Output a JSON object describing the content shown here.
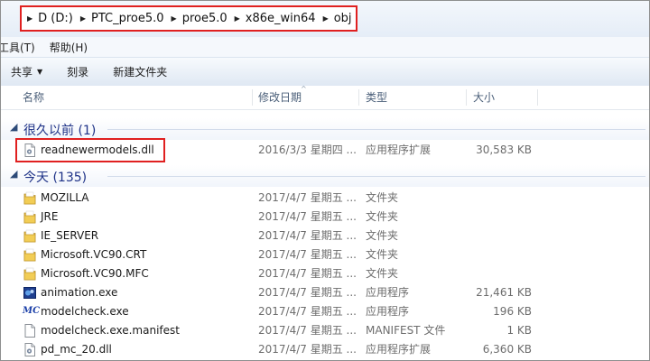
{
  "address": {
    "crumbs": [
      "D (D:)",
      "PTC_proe5.0",
      "proe5.0",
      "x86e_win64",
      "obj"
    ]
  },
  "menu": {
    "items": [
      "工具(T)",
      "帮助(H)"
    ]
  },
  "toolbar": {
    "share_label": "共享",
    "burn_label": "刻录",
    "new_folder_label": "新建文件夹"
  },
  "columns": {
    "name": "名称",
    "date": "修改日期",
    "type": "类型",
    "size": "大小"
  },
  "groups": [
    {
      "title": "很久以前 (1)",
      "files": [
        {
          "name": "readnewermodels.dll",
          "date": "2016/3/3 星期四 ...",
          "type": "应用程序扩展",
          "size": "30,583 KB",
          "icon": "dll-file-icon"
        }
      ]
    },
    {
      "title": "今天 (135)",
      "files": [
        {
          "name": "MOZILLA",
          "date": "2017/4/7 星期五 ...",
          "type": "文件夹",
          "size": "",
          "icon": "folder-icon"
        },
        {
          "name": "JRE",
          "date": "2017/4/7 星期五 ...",
          "type": "文件夹",
          "size": "",
          "icon": "folder-icon"
        },
        {
          "name": "IE_SERVER",
          "date": "2017/4/7 星期五 ...",
          "type": "文件夹",
          "size": "",
          "icon": "folder-icon"
        },
        {
          "name": "Microsoft.VC90.CRT",
          "date": "2017/4/7 星期五 ...",
          "type": "文件夹",
          "size": "",
          "icon": "folder-icon"
        },
        {
          "name": "Microsoft.VC90.MFC",
          "date": "2017/4/7 星期五 ...",
          "type": "文件夹",
          "size": "",
          "icon": "folder-icon"
        },
        {
          "name": "animation.exe",
          "date": "2017/4/7 星期五 ...",
          "type": "应用程序",
          "size": "21,461 KB",
          "icon": "animation-exe-icon"
        },
        {
          "name": "modelcheck.exe",
          "date": "2017/4/7 星期五 ...",
          "type": "应用程序",
          "size": "196 KB",
          "icon": "mc-exe-icon",
          "icon_text": "MC"
        },
        {
          "name": "modelcheck.exe.manifest",
          "date": "2017/4/7 星期五 ...",
          "type": "MANIFEST 文件",
          "size": "1 KB",
          "icon": "blank-file-icon"
        },
        {
          "name": "pd_mc_20.dll",
          "date": "2017/4/7 星期五 ...",
          "type": "应用程序扩展",
          "size": "6,360 KB",
          "icon": "dll-file-icon"
        }
      ]
    }
  ],
  "colors": {
    "highlight": "#e02020",
    "group_title": "#1e3287",
    "folder": "#e8c04a"
  }
}
